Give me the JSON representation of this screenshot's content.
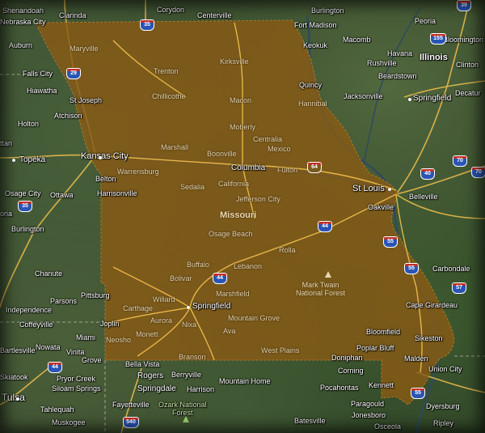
{
  "map": {
    "state": "Missouri",
    "state_fill": "#8a5a14",
    "road_color": "#f2c14e",
    "forests": [
      "Mark Twain\nNational Forest",
      "Ozark National\nForest"
    ],
    "states_outside": [
      "Illinois"
    ],
    "places_inside": [
      "Maryville",
      "Trenton",
      "Kirksville",
      "Chillicothe",
      "Macon",
      "Hannibal",
      "Moberly",
      "Centralia",
      "Mexico",
      "Marshall",
      "Boonville",
      "Columbia",
      "Fulton",
      "Warrensburg",
      "Sedalia",
      "California",
      "Jefferson City",
      "Osage Beach",
      "Rolla",
      "Buffalo",
      "Lebanon",
      "Bolivar",
      "Marshfield",
      "Willard",
      "Springfield",
      "Carthage",
      "Aurora",
      "Mountain Grove",
      "Monett",
      "Nixa",
      "Ava",
      "Neosho",
      "West Plains",
      "Branson",
      "Bloomfield",
      "Poplar Bluff",
      "Doniphan",
      "Sikeston",
      "Kennett",
      "Cape Girardeau",
      "Belton",
      "Harrisonville"
    ],
    "places_outside": [
      "Shenandoah",
      "Clarinda",
      "Corydon",
      "Centerville",
      "Burlington",
      "Peoria",
      "Nebraska City",
      "Fort Madison",
      "Macomb",
      "Bloomington",
      "Auburn",
      "Keokuk",
      "Havana",
      "Rushville",
      "Clinton",
      "Beardstown",
      "Falls City",
      "Quincy",
      "Jacksonville",
      "Springfield",
      "Decatur",
      "Hiawatha",
      "St Joseph",
      "Atchison",
      "Holton",
      "Topeka",
      "Kansas City",
      "Ottawa",
      "Osage City",
      "St Louis",
      "Belleville",
      "Burlington",
      "Oakville",
      "Chanute",
      "Parsons",
      "Independence",
      "Pittsburg",
      "Joplin",
      "Carbondale",
      "Coffeyville",
      "Miami",
      "Nowata",
      "Vinita",
      "Grove",
      "Bella Vista",
      "Berryville",
      "Rogers",
      "Springdale",
      "Harrison",
      "Mountain Home",
      "Corning",
      "Pocahontas",
      "Paragould",
      "Jonesboro",
      "Dyersburg",
      "Union City",
      "Malden",
      "Fayetteville",
      "Tulsa",
      "Tahlequah",
      "Muskogee",
      "Batesville",
      "Osceola",
      "Ripley",
      "Skiatook",
      "Pryor Creek",
      "Siloam Springs",
      "Bartlesville"
    ],
    "abbreviated": [
      "ttan",
      "oria"
    ],
    "shields": [
      "35",
      "29",
      "35",
      "39",
      "155",
      "70",
      "70",
      "40",
      "44",
      "44",
      "55",
      "57",
      "44",
      "55",
      "55",
      "64",
      "540",
      "44",
      "35",
      "70"
    ]
  }
}
